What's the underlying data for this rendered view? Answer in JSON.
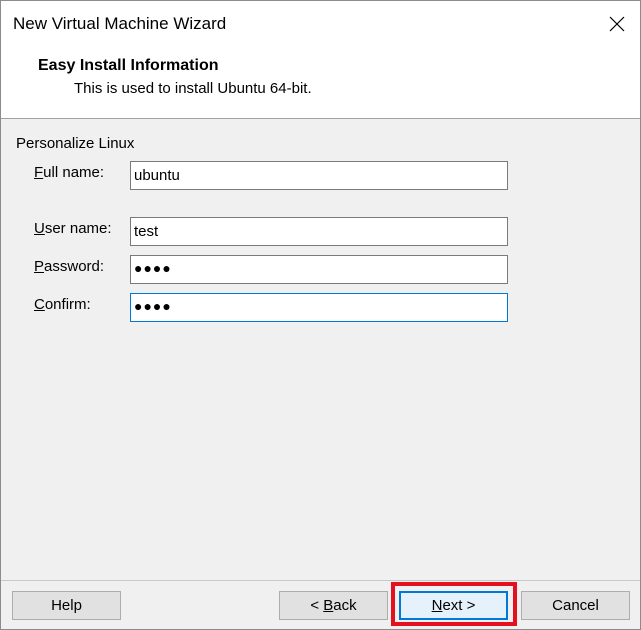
{
  "window": {
    "title": "New Virtual Machine Wizard"
  },
  "header": {
    "title": "Easy Install Information",
    "subtitle": "This is used to install Ubuntu 64-bit."
  },
  "form": {
    "group_label": "Personalize Linux",
    "full_name": {
      "label_accel": "F",
      "label_rest": "ull name:",
      "value": "ubuntu"
    },
    "user_name": {
      "label_accel": "U",
      "label_rest": "ser name:",
      "value": "test"
    },
    "password": {
      "label_accel": "P",
      "label_rest": "assword:",
      "masked": "●●●●"
    },
    "confirm": {
      "label_accel": "C",
      "label_rest": "onfirm:",
      "masked": "●●●●"
    }
  },
  "footer": {
    "help_label": "Help",
    "back": {
      "prefix": "< ",
      "accel": "B",
      "rest": "ack"
    },
    "next": {
      "accel": "N",
      "rest": "ext >"
    },
    "cancel_label": "Cancel"
  },
  "colors": {
    "focus_border": "#0078d7",
    "highlight": "#e3101f"
  },
  "icons": {
    "close": "close-icon"
  }
}
